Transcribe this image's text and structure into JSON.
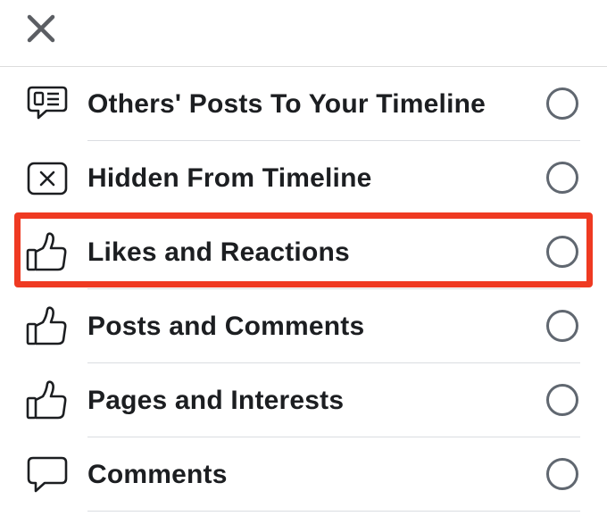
{
  "header": {
    "close_icon": "close-icon"
  },
  "colors": {
    "text": "#1c1e21",
    "icon": "#1c1e21",
    "radio_border": "#606770",
    "divider": "#dadde1",
    "highlight": "#ef3a22"
  },
  "items": [
    {
      "label": "Others' Posts To Your Timeline",
      "icon": "timeline-post-icon",
      "selected": false
    },
    {
      "label": "Hidden From Timeline",
      "icon": "hidden-box-icon",
      "selected": false
    },
    {
      "label": "Likes and Reactions",
      "icon": "thumbs-up-icon",
      "selected": false,
      "highlighted": true
    },
    {
      "label": "Posts and Comments",
      "icon": "thumbs-up-icon",
      "selected": false
    },
    {
      "label": "Pages and Interests",
      "icon": "thumbs-up-icon",
      "selected": false
    },
    {
      "label": "Comments",
      "icon": "comment-bubble-icon",
      "selected": false
    }
  ]
}
